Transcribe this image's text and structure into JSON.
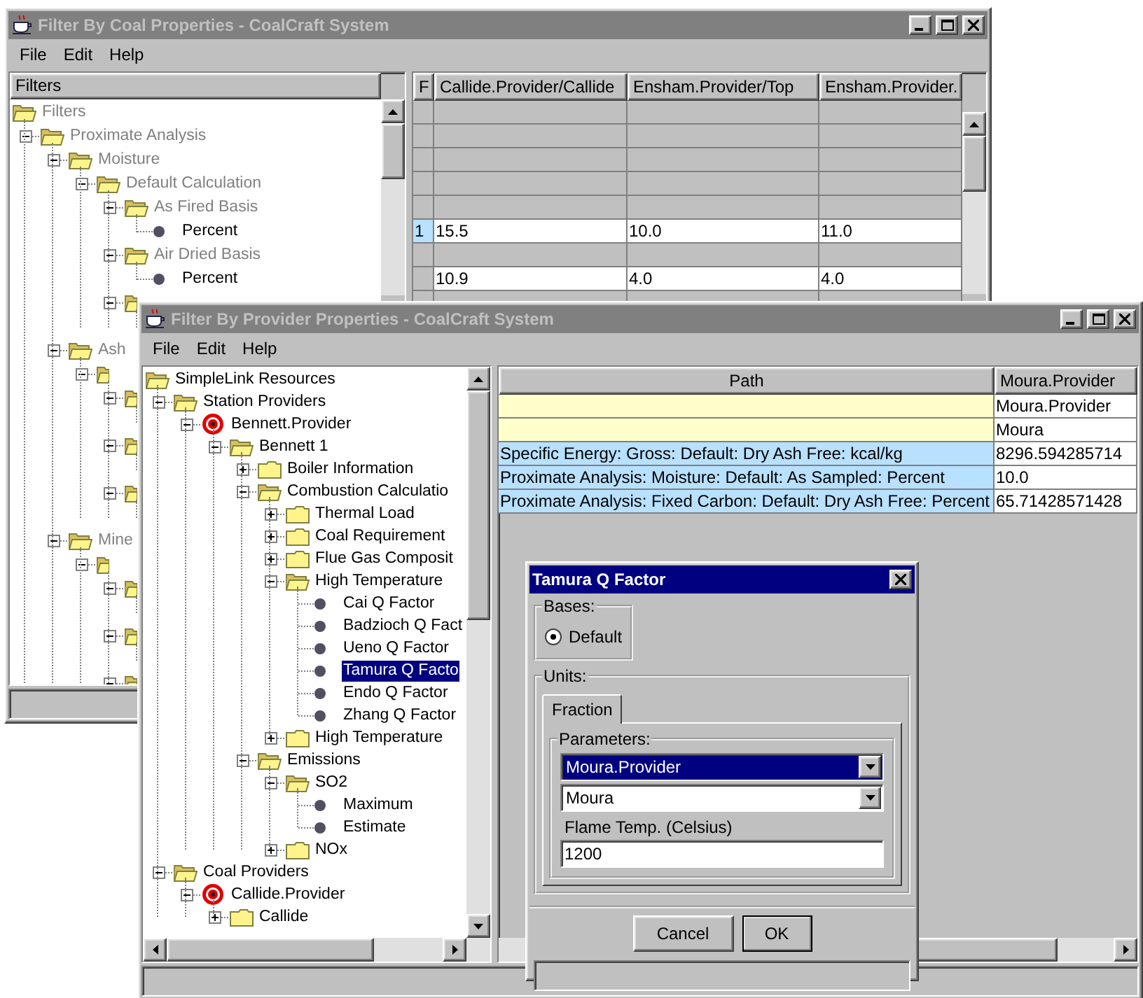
{
  "back_window": {
    "title": "Filter By Coal Properties - CoalCraft System",
    "active": false,
    "menu": [
      "File",
      "Edit",
      "Help"
    ],
    "tree_header": "Filters",
    "tree": [
      {
        "label": "Filters",
        "kind": "folder",
        "disabled": true,
        "children": [
          {
            "label": "Proximate Analysis",
            "kind": "folder",
            "disabled": true,
            "expanded": true,
            "children": [
              {
                "label": "Moisture",
                "kind": "folder",
                "disabled": true,
                "expanded": true,
                "children": [
                  {
                    "label": "Default Calculation",
                    "kind": "folder",
                    "disabled": true,
                    "expanded": true,
                    "children": [
                      {
                        "label": "As Fired Basis",
                        "kind": "folder",
                        "disabled": true,
                        "expanded": true,
                        "children": [
                          {
                            "label": "Percent",
                            "kind": "leaf",
                            "disabled": false
                          }
                        ]
                      },
                      {
                        "label": "Air Dried Basis",
                        "kind": "folder",
                        "disabled": true,
                        "expanded": true,
                        "children": [
                          {
                            "label": "Percent",
                            "kind": "leaf",
                            "disabled": false
                          }
                        ]
                      },
                      {
                        "kind": "folder",
                        "expanded": true,
                        "children": [
                          {
                            "kind": "leaf"
                          }
                        ]
                      }
                    ]
                  }
                ]
              },
              {
                "label": "Ash",
                "kind": "folder",
                "disabled": true,
                "expanded": true,
                "children": [
                  {
                    "kind": "folder",
                    "expanded": true,
                    "children": [
                      {
                        "kind": "folder",
                        "expanded": true,
                        "children": [
                          {
                            "kind": "leaf"
                          }
                        ]
                      },
                      {
                        "kind": "folder",
                        "expanded": true,
                        "children": [
                          {
                            "kind": "leaf"
                          }
                        ]
                      },
                      {
                        "kind": "folder",
                        "expanded": true,
                        "children": [
                          {
                            "kind": "leaf"
                          }
                        ]
                      }
                    ]
                  }
                ]
              },
              {
                "label": "Mine",
                "kind": "folder",
                "disabled": true,
                "expanded": true,
                "children": [
                  {
                    "kind": "folder",
                    "expanded": true,
                    "children": [
                      {
                        "kind": "folder",
                        "expanded": true,
                        "children": [
                          {
                            "kind": "leaf"
                          }
                        ]
                      },
                      {
                        "kind": "folder",
                        "expanded": true,
                        "children": [
                          {
                            "kind": "leaf"
                          }
                        ]
                      },
                      {
                        "kind": "folder",
                        "expanded": true,
                        "children": [
                          {
                            "kind": "leaf"
                          }
                        ]
                      }
                    ]
                  }
                ]
              }
            ]
          }
        ]
      }
    ],
    "table": {
      "columns": [
        "F",
        "Callide.Provider/Callide",
        "Ensham.Provider/Top",
        "Ensham.Provider."
      ],
      "rows": [
        {
          "kind": "empty"
        },
        {
          "kind": "empty"
        },
        {
          "kind": "empty"
        },
        {
          "kind": "empty"
        },
        {
          "kind": "empty"
        },
        {
          "kind": "data",
          "row_header": "1",
          "cells": [
            "15.5",
            "10.0",
            "11.0"
          ]
        },
        {
          "kind": "empty"
        },
        {
          "kind": "data",
          "cells": [
            "10.9",
            "4.0",
            "4.0"
          ]
        },
        {
          "kind": "empty"
        }
      ]
    }
  },
  "front_window": {
    "title": "Filter By Provider Properties - CoalCraft System",
    "active": false,
    "menu": [
      "File",
      "Edit",
      "Help"
    ],
    "tree": [
      {
        "label": "SimpleLink Resources",
        "kind": "folder",
        "selected": false,
        "children": [
          {
            "label": "Station Providers",
            "kind": "folder",
            "selected": false,
            "expanded": true,
            "children": [
              {
                "label": "Bennett.Provider",
                "kind": "target",
                "selected": false,
                "expanded": true,
                "children": [
                  {
                    "label": "Bennett 1",
                    "kind": "folder",
                    "selected": false,
                    "expanded": true,
                    "children": [
                      {
                        "label": "Boiler Information",
                        "kind": "folder",
                        "selected": false,
                        "expanded": false
                      },
                      {
                        "label": "Combustion Calculatio",
                        "kind": "folder",
                        "selected": false,
                        "expanded": true,
                        "children": [
                          {
                            "label": "Thermal Load",
                            "kind": "folder",
                            "selected": false,
                            "expanded": false
                          },
                          {
                            "label": "Coal Requirement",
                            "kind": "folder",
                            "selected": false,
                            "expanded": false
                          },
                          {
                            "label": "Flue Gas Composit",
                            "kind": "folder",
                            "selected": false,
                            "expanded": false
                          },
                          {
                            "label": "High Temperature",
                            "kind": "folder",
                            "selected": false,
                            "expanded": true,
                            "children": [
                              {
                                "label": "Cai Q Factor",
                                "kind": "leaf",
                                "selected": false
                              },
                              {
                                "label": "Badzioch Q Fact",
                                "kind": "leaf",
                                "selected": false
                              },
                              {
                                "label": "Ueno Q Factor",
                                "kind": "leaf",
                                "selected": false
                              },
                              {
                                "label": "Tamura Q Facto",
                                "kind": "leaf",
                                "selected": true
                              },
                              {
                                "label": "Endo Q Factor",
                                "kind": "leaf",
                                "selected": false
                              },
                              {
                                "label": "Zhang Q Factor",
                                "kind": "leaf",
                                "selected": false
                              }
                            ]
                          },
                          {
                            "label": "High Temperature",
                            "kind": "folder",
                            "selected": false,
                            "expanded": false
                          }
                        ]
                      },
                      {
                        "label": "Emissions",
                        "kind": "folder",
                        "selected": false,
                        "expanded": true,
                        "children": [
                          {
                            "label": "SO2",
                            "kind": "folder",
                            "selected": false,
                            "expanded": true,
                            "children": [
                              {
                                "label": "Maximum",
                                "kind": "leaf",
                                "selected": false
                              },
                              {
                                "label": "Estimate",
                                "kind": "leaf",
                                "selected": false
                              }
                            ]
                          },
                          {
                            "label": "NOx",
                            "kind": "folder",
                            "selected": false,
                            "expanded": false
                          }
                        ]
                      }
                    ]
                  }
                ]
              }
            ]
          },
          {
            "label": "Coal Providers",
            "kind": "folder",
            "selected": false,
            "expanded": true,
            "children": [
              {
                "label": "Callide.Provider",
                "kind": "target",
                "selected": false,
                "expanded": true,
                "children": [
                  {
                    "label": "Callide",
                    "kind": "folder",
                    "selected": false,
                    "expanded": false
                  }
                ]
              }
            ]
          }
        ]
      }
    ],
    "table": {
      "columns": [
        "Path",
        "Moura.Provider"
      ],
      "rows": [
        {
          "kind": "provider",
          "value": "Moura.Provider"
        },
        {
          "kind": "provider",
          "value": "Moura"
        },
        {
          "kind": "property",
          "path": "Specific Energy: Gross: Default: Dry Ash Free: kcal/kg",
          "value": "8296.594285714"
        },
        {
          "kind": "property",
          "path": "Proximate Analysis: Moisture: Default: As Sampled: Percent",
          "value": "10.0"
        },
        {
          "kind": "property",
          "path": "Proximate Analysis: Fixed Carbon: Default: Dry Ash Free: Percent",
          "value": "65.71428571428"
        }
      ]
    }
  },
  "dialog": {
    "title": "Tamura Q Factor",
    "active": true,
    "bases": {
      "label": "Bases:",
      "options": [
        {
          "label": "Default",
          "selected": true
        }
      ]
    },
    "units": {
      "label": "Units:",
      "tabs": [
        {
          "label": "Fraction",
          "selected": true
        }
      ],
      "parameters": {
        "label": "Parameters:",
        "combos": [
          {
            "value": "Moura.Provider",
            "focused": true
          },
          {
            "value": "Moura",
            "focused": false
          }
        ],
        "field": {
          "label": "Flame Temp. (Celsius)",
          "value": "1200"
        }
      }
    },
    "buttons": [
      {
        "label": "Cancel",
        "default": false
      },
      {
        "label": "OK",
        "default": true
      }
    ]
  }
}
